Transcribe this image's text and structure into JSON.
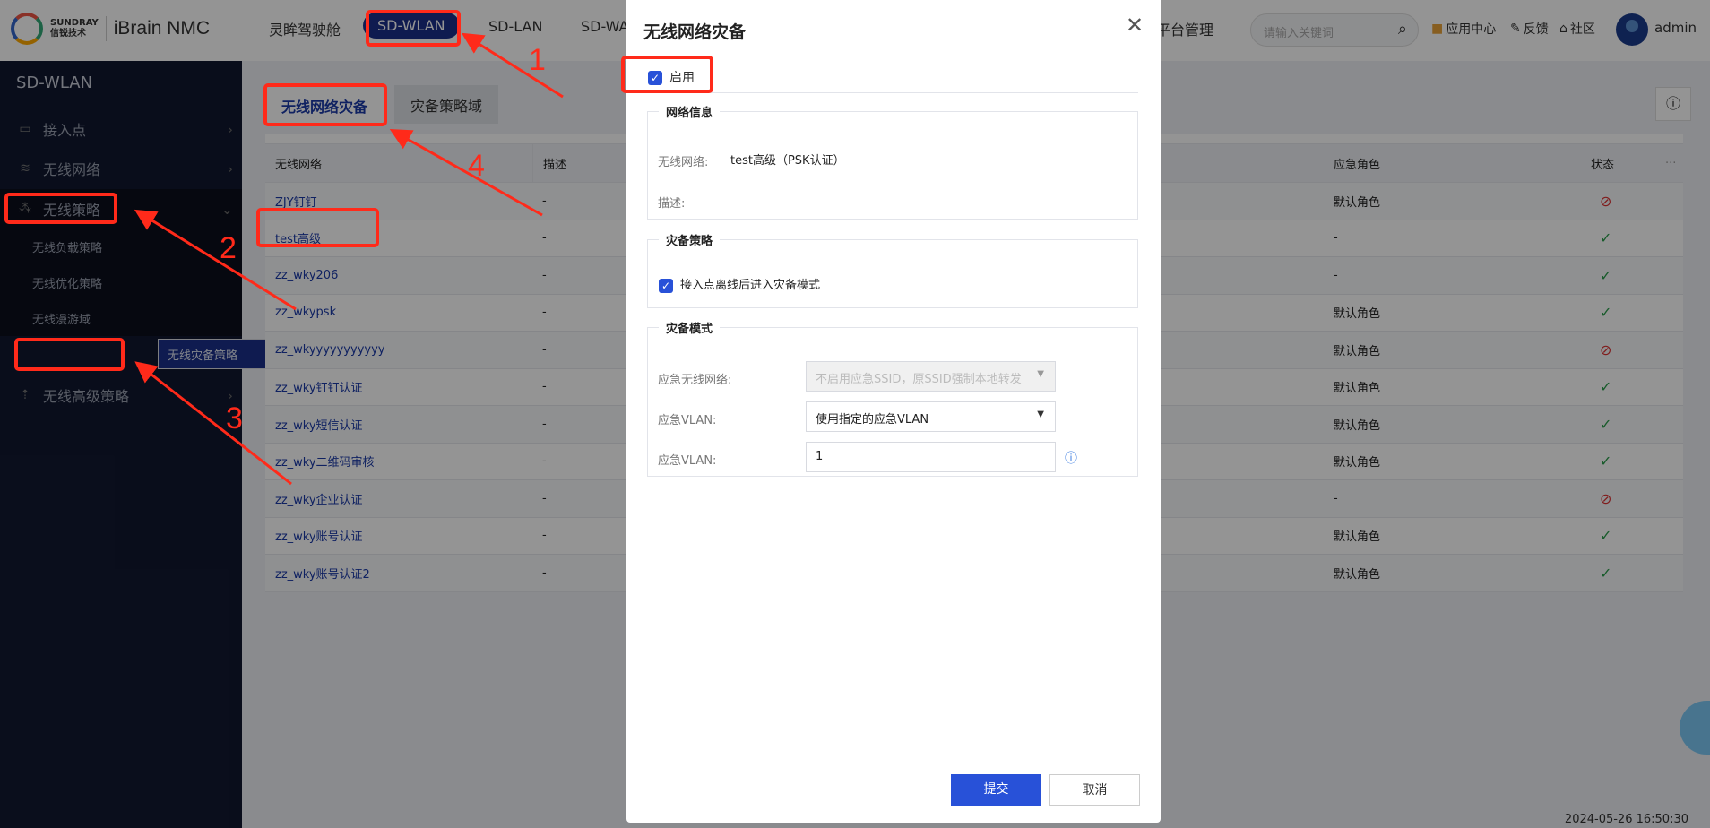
{
  "header": {
    "brand_en": "SUNDRAY",
    "brand_cn": "信锐技术",
    "product": "iBrain NMC",
    "nav": [
      "灵眸驾驶舱",
      "SD-WLAN",
      "SD-LAN",
      "SD-WA",
      "平台管理"
    ],
    "active_nav": "SD-WLAN",
    "search_placeholder": "请输入关键词",
    "app_center": "应用中心",
    "feedback": "反馈",
    "community": "社区",
    "user": "admin"
  },
  "sidebar": {
    "title": "SD-WLAN",
    "items": [
      {
        "label": "接入点",
        "icon": "router-icon"
      },
      {
        "label": "无线网络",
        "icon": "wifi-icon"
      },
      {
        "label": "无线策略",
        "icon": "policy-icon",
        "expanded": true
      },
      {
        "label": "无线高级策略",
        "icon": "advanced-icon"
      }
    ],
    "subitems": [
      "无线负载策略",
      "无线优化策略",
      "无线漫游域",
      "无线灾备策略"
    ],
    "selected_subitem": "无线灾备策略"
  },
  "tabs": [
    "无线网络灾备",
    "灾备策略域"
  ],
  "active_tab": "无线网络灾备",
  "table": {
    "columns": [
      "无线网络",
      "描述",
      "应急角色",
      "状态",
      "···"
    ],
    "rows": [
      {
        "name": "ZJY钉钉",
        "desc": "-",
        "role": "默认角色",
        "status": "disabled"
      },
      {
        "name": "test高级",
        "desc": "-",
        "role": "-",
        "status": "enabled"
      },
      {
        "name": "zz_wky206",
        "desc": "-",
        "role": "-",
        "status": "enabled"
      },
      {
        "name": "zz_wkypsk",
        "desc": "-",
        "role": "默认角色",
        "status": "enabled"
      },
      {
        "name": "zz_wkyyyyyyyyyyy",
        "desc": "-",
        "role": "默认角色",
        "status": "disabled"
      },
      {
        "name": "zz_wky钉钉认证",
        "desc": "-",
        "role": "默认角色",
        "status": "enabled"
      },
      {
        "name": "zz_wky短信认证",
        "desc": "-",
        "role": "默认角色",
        "status": "enabled"
      },
      {
        "name": "zz_wky二维码审核",
        "desc": "-",
        "role": "默认角色",
        "status": "enabled"
      },
      {
        "name": "zz_wky企业认证",
        "desc": "-",
        "role": "-",
        "status": "disabled"
      },
      {
        "name": "zz_wky账号认证",
        "desc": "-",
        "role": "默认角色",
        "status": "enabled"
      },
      {
        "name": "zz_wky账号认证2",
        "desc": "-",
        "role": "默认角色",
        "status": "enabled"
      }
    ]
  },
  "timestamp": "2024-05-26 16:50:30",
  "modal": {
    "title": "无线网络灾备",
    "enable_label": "启用",
    "enabled": true,
    "network_info": {
      "legend": "网络信息",
      "network_label": "无线网络:",
      "network_value": "test高级（PSK认证）",
      "desc_label": "描述:"
    },
    "policy": {
      "legend": "灾备策略",
      "checkbox_label": "接入点离线后进入灾备模式",
      "checked": true
    },
    "mode": {
      "legend": "灾备模式",
      "emergency_network_label": "应急无线网络:",
      "emergency_network_value": "不启用应急SSID，原SSID强制本地转发",
      "vlan_mode_label": "应急VLAN:",
      "vlan_mode_value": "使用指定的应急VLAN",
      "vlan_label": "应急VLAN:",
      "vlan_value": "1"
    },
    "submit": "提交",
    "cancel": "取消"
  },
  "annotations": {
    "color": "#ff2a1a",
    "numbers": [
      "1",
      "2",
      "3",
      "4"
    ]
  },
  "colors": {
    "primary": "#2851d8",
    "sidebar_bg": "#111830",
    "selected": "#1b2f8a",
    "ok": "#2a9d4a",
    "ban": "#d33333"
  }
}
